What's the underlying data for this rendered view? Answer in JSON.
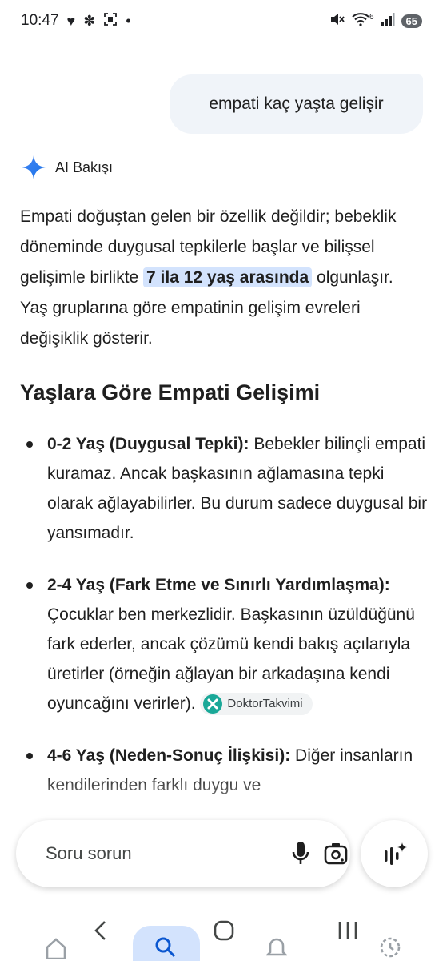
{
  "status_bar": {
    "time": "10:47",
    "battery": "65",
    "network": "6"
  },
  "query": {
    "text": "empati kaç yaşta gelişir"
  },
  "ai_overview": {
    "label": "AI Bakışı",
    "intro_part1": "Empati doğuştan gelen bir özellik değildir; bebeklik döneminde duygusal tepkilerle başlar ve bilişsel gelişimle birlikte ",
    "intro_highlight": "7 ila 12 yaş arasında",
    "intro_part2": " olgunlaşır. Yaş gruplarına göre empatinin gelişim evreleri değişiklik gösterir.",
    "section_title": "Yaşlara Göre Empati Gelişimi",
    "items": [
      {
        "title": "0-2 Yaş (Duygusal Tepki):",
        "text": " Bebekler bilinçli empati kuramaz. Ancak başkasının ağlamasına tepki olarak ağlayabilirler. Bu durum sadece duygusal bir yansımadır."
      },
      {
        "title": "2-4 Yaş (Fark Etme ve Sınırlı Yardımlaşma):",
        "text": " Çocuklar ben merkezlidir. Başkasının üzüldüğünü fark ederler, ancak çözümü kendi bakış açılarıyla üretirler (örneğin ağlayan bir arkadaşına kendi oyuncağını verirler).",
        "source": "DoktorTakvimi"
      },
      {
        "title": "4-6 Yaş (Neden-Sonuç İlişkisi):",
        "text": " Diğer insanların kendilerinden farklı duygu ve"
      }
    ]
  },
  "input": {
    "placeholder": "Soru sorun"
  },
  "colors": {
    "accent": "#1a73e8",
    "highlight": "#d3e3fd",
    "bubble": "#f0f4f9"
  }
}
